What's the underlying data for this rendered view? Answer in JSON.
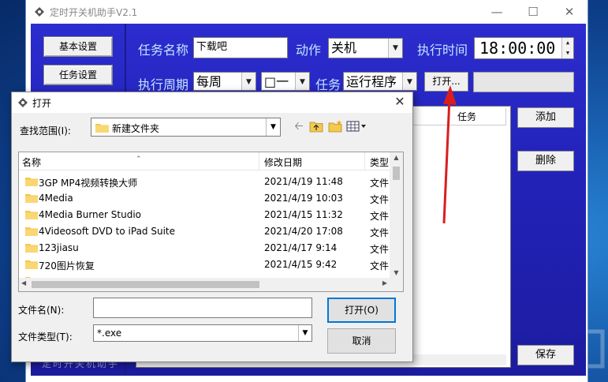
{
  "app": {
    "title": "定时开关机助手V2.1",
    "left_buttons": [
      "基本设置",
      "任务设置"
    ],
    "left_footer_text": "定时开关机助手",
    "task_name_label": "任务名称",
    "task_name_value": "下载吧",
    "action_label": "动作",
    "action_value": "关机",
    "exec_time_label": "执行时间",
    "exec_time_value": "18:00:00",
    "period_label": "执行周期",
    "period_value": "每周",
    "day_value": "□一",
    "task_label": "任务",
    "task_value": "运行程序",
    "open_button": "打开...",
    "table_header_task": "任务",
    "add_button": "添加",
    "delete_button": "删除",
    "save_button": "保存"
  },
  "dialog": {
    "title": "打开",
    "look_in_label": "查找范围(I):",
    "look_in_value": "新建文件夹",
    "columns": [
      "名称",
      "修改日期",
      "类型"
    ],
    "files": [
      {
        "name": "3GP MP4视频转换大师",
        "date": "2021/4/19 11:48",
        "type": "文件"
      },
      {
        "name": "4Media",
        "date": "2021/4/19 10:03",
        "type": "文件"
      },
      {
        "name": "4Media Burner Studio",
        "date": "2021/4/15 11:32",
        "type": "文件"
      },
      {
        "name": "4Videosoft DVD to iPad Suite",
        "date": "2021/4/20 17:08",
        "type": "文件"
      },
      {
        "name": "123jiasu",
        "date": "2021/4/17 9:14",
        "type": "文件"
      },
      {
        "name": "720图片恢复",
        "date": "2021/4/15 9:42",
        "type": "文件"
      }
    ],
    "filename_label": "文件名(N):",
    "filename_value": "",
    "filetype_label": "文件类型(T):",
    "filetype_value": "*.exe",
    "open_button": "打开(O)",
    "cancel_button": "取消"
  },
  "colors": {
    "panel_blue": "#2222b8",
    "label_blue": "#c3e5ff",
    "annotation_red": "#d81e1e"
  }
}
